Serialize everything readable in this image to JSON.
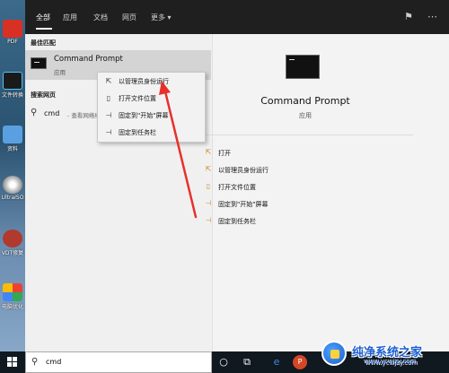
{
  "desktop": {
    "icons": [
      {
        "label": "PDF",
        "color": "#d93025"
      },
      {
        "label": "文件转换",
        "color": "#1a1a1a"
      },
      {
        "label": "资料",
        "color": "#5aa0e0"
      },
      {
        "label": "UltraISO",
        "color": "#c0c0c0"
      },
      {
        "label": "VDT修复",
        "color": "#b03a2e"
      },
      {
        "label": "电脑优化",
        "color": "#e8e8e8"
      }
    ]
  },
  "start_menu": {
    "tabs": [
      {
        "label": "全部",
        "active": true
      },
      {
        "label": "应用",
        "active": false
      },
      {
        "label": "文档",
        "active": false
      },
      {
        "label": "网页",
        "active": false
      },
      {
        "label": "更多 ▾",
        "active": false
      }
    ],
    "best_match": {
      "section_title": "最佳匹配",
      "title": "Command Prompt",
      "subtitle": "应用"
    },
    "web": {
      "section_title": "搜索网页",
      "query": "cmd",
      "hint": "- 查看网络结果"
    }
  },
  "context_menu": {
    "items": [
      {
        "label": "以管理员身份运行",
        "icon": "shield-run-icon"
      },
      {
        "label": "打开文件位置",
        "icon": "folder-location-icon"
      },
      {
        "label": "固定到\"开始\"屏幕",
        "icon": "pin-icon"
      },
      {
        "label": "固定到任务栏",
        "icon": "pin-taskbar-icon"
      }
    ]
  },
  "detail_pane": {
    "title": "Command Prompt",
    "subtitle": "应用",
    "actions": [
      {
        "label": "打开",
        "icon": "open-icon"
      },
      {
        "label": "以管理员身份运行",
        "icon": "shield-run-icon"
      },
      {
        "label": "打开文件位置",
        "icon": "folder-location-icon"
      },
      {
        "label": "固定到\"开始\"屏幕",
        "icon": "pin-icon"
      },
      {
        "label": "固定到任务栏",
        "icon": "pin-taskbar-icon"
      }
    ]
  },
  "taskbar": {
    "search_text": "cmd"
  },
  "watermark": {
    "title": "纯净系统之家",
    "url": "www.ycwjzy.com"
  },
  "colors": {
    "accent": "#0078d7",
    "arrow": "#e8302a"
  }
}
